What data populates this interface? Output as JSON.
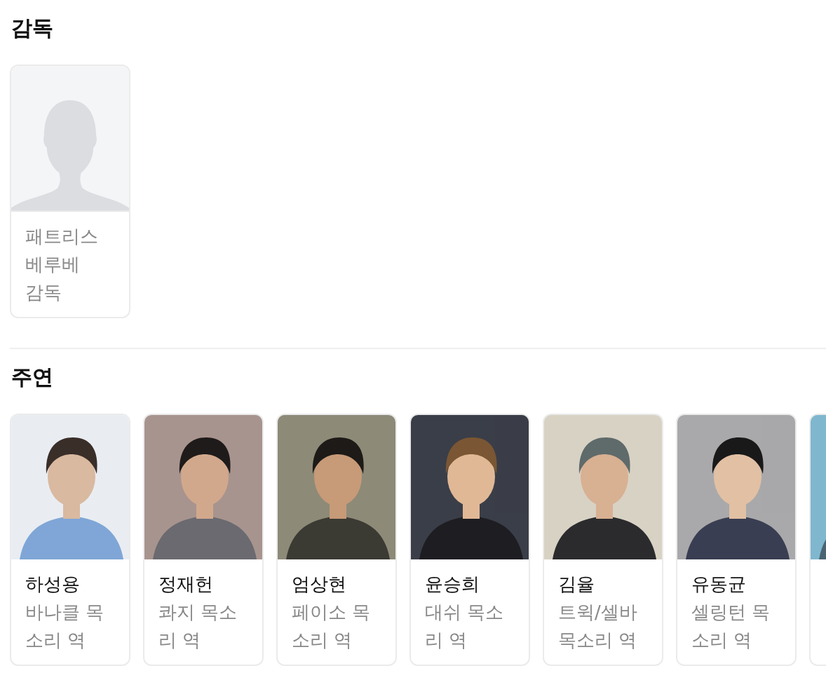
{
  "sections": [
    {
      "title": "감독",
      "people": [
        {
          "kind": "placeholder",
          "name": "패트리스 베루베",
          "role": "감독"
        }
      ]
    },
    {
      "title": "주연",
      "people": [
        {
          "kind": "picture",
          "name": "하성용",
          "role": "바나클 목소리 역"
        },
        {
          "kind": "picture",
          "name": "정재헌",
          "role": "콰지 목소리 역"
        },
        {
          "kind": "picture",
          "name": "엄상현",
          "role": "페이소 목소리 역"
        },
        {
          "kind": "picture",
          "name": "윤승희",
          "role": "대쉬 목소리 역"
        },
        {
          "kind": "picture",
          "name": "김율",
          "role": "트윅/셀바 목소리 역"
        },
        {
          "kind": "picture",
          "name": "유동균",
          "role": "셀링턴 목소리 역"
        },
        {
          "kind": "picture"
        }
      ]
    }
  ]
}
